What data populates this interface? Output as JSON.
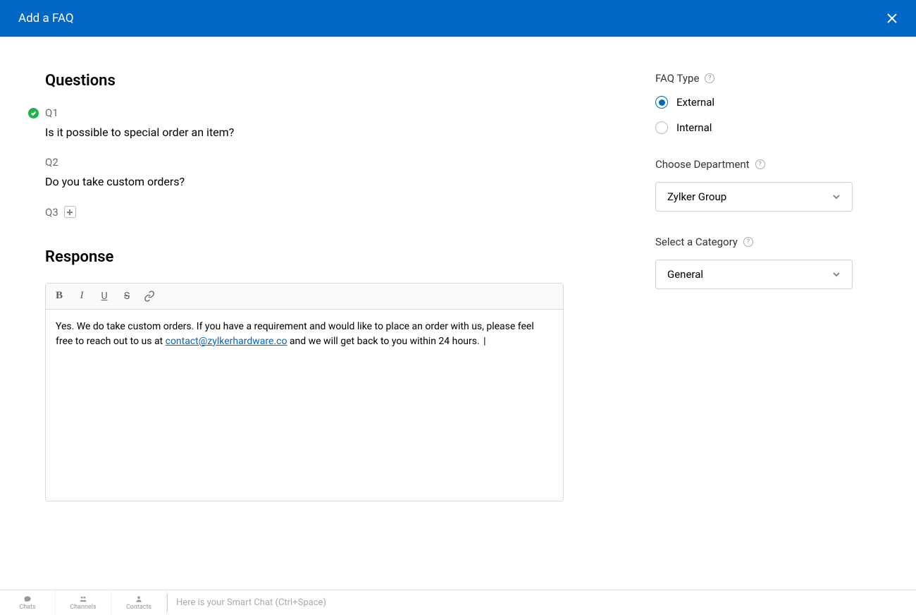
{
  "header": {
    "title": "Add a FAQ"
  },
  "questions": {
    "heading": "Questions",
    "q1_label": "Q1",
    "q1_text": "Is it possible to special order an item?",
    "q2_label": "Q2",
    "q2_text": "Do you take custom orders?",
    "q3_label": "Q3"
  },
  "response": {
    "heading": "Response",
    "text_before": "Yes. We do take custom orders. If you have a requirement and would like to place an order with us, please feel free to reach out to us at ",
    "email": "contact@zylkerhardware.co",
    "text_after": " and we will get back to you within 24 hours. "
  },
  "sidebar": {
    "faq_type_label": "FAQ Type",
    "faq_type_options": {
      "external": "External",
      "internal": "Internal"
    },
    "faq_type_selected": "external",
    "department_label": "Choose Department",
    "department_value": "Zylker Group",
    "category_label": "Select a Category",
    "category_value": "General"
  },
  "bottombar": {
    "tabs": {
      "chats": "Chats",
      "channels": "Channels",
      "contacts": "Contacts"
    },
    "smart_chat_placeholder": "Here is your Smart Chat (Ctrl+Space)"
  }
}
